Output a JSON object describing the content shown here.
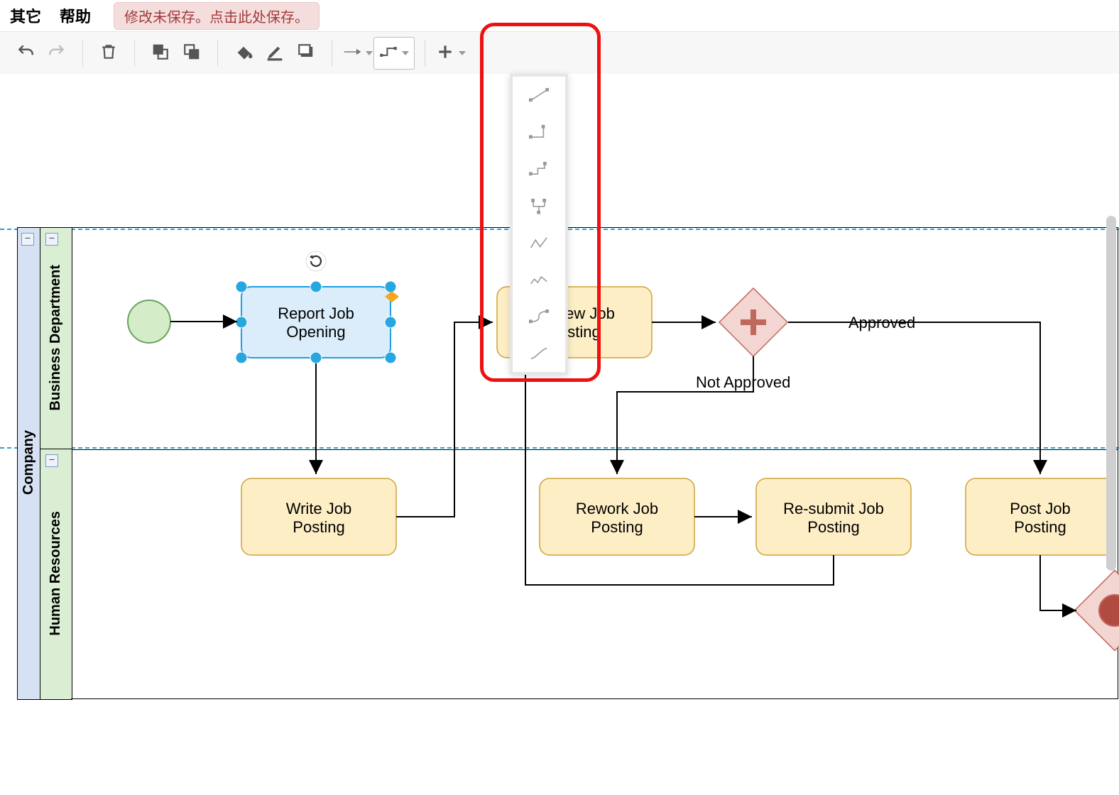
{
  "menu": {
    "other": "其它",
    "help": "帮助",
    "save_warning": "修改未保存。点击此处保存。"
  },
  "pool": {
    "label": "Company"
  },
  "lanes": [
    {
      "id": "biz",
      "label": "Business Department"
    },
    {
      "id": "hr",
      "label": "Human Resources"
    }
  ],
  "tasks": {
    "report": "Report Job Opening",
    "review": "Review Job Posting",
    "write": "Write Job Posting",
    "rework": "Rework Job Posting",
    "resubmit": "Re-submit Job Posting",
    "post": "Post Job Posting"
  },
  "edge_labels": {
    "approved": "Approved",
    "not_approved": "Not Approved"
  },
  "connector_styles": [
    "straight",
    "orthogonal",
    "orthogonal-routed",
    "vertical-tree",
    "zigzag",
    "jagged",
    "curved",
    "curved-smooth"
  ],
  "toolbar": {
    "undo": "undo",
    "redo": "redo",
    "delete": "delete",
    "front": "bring-to-front",
    "back": "send-to-back",
    "fill": "fill-color",
    "line": "line-color",
    "shadow": "shadow",
    "arrow": "arrow-style",
    "connector": "connector-style",
    "add": "add-element"
  }
}
